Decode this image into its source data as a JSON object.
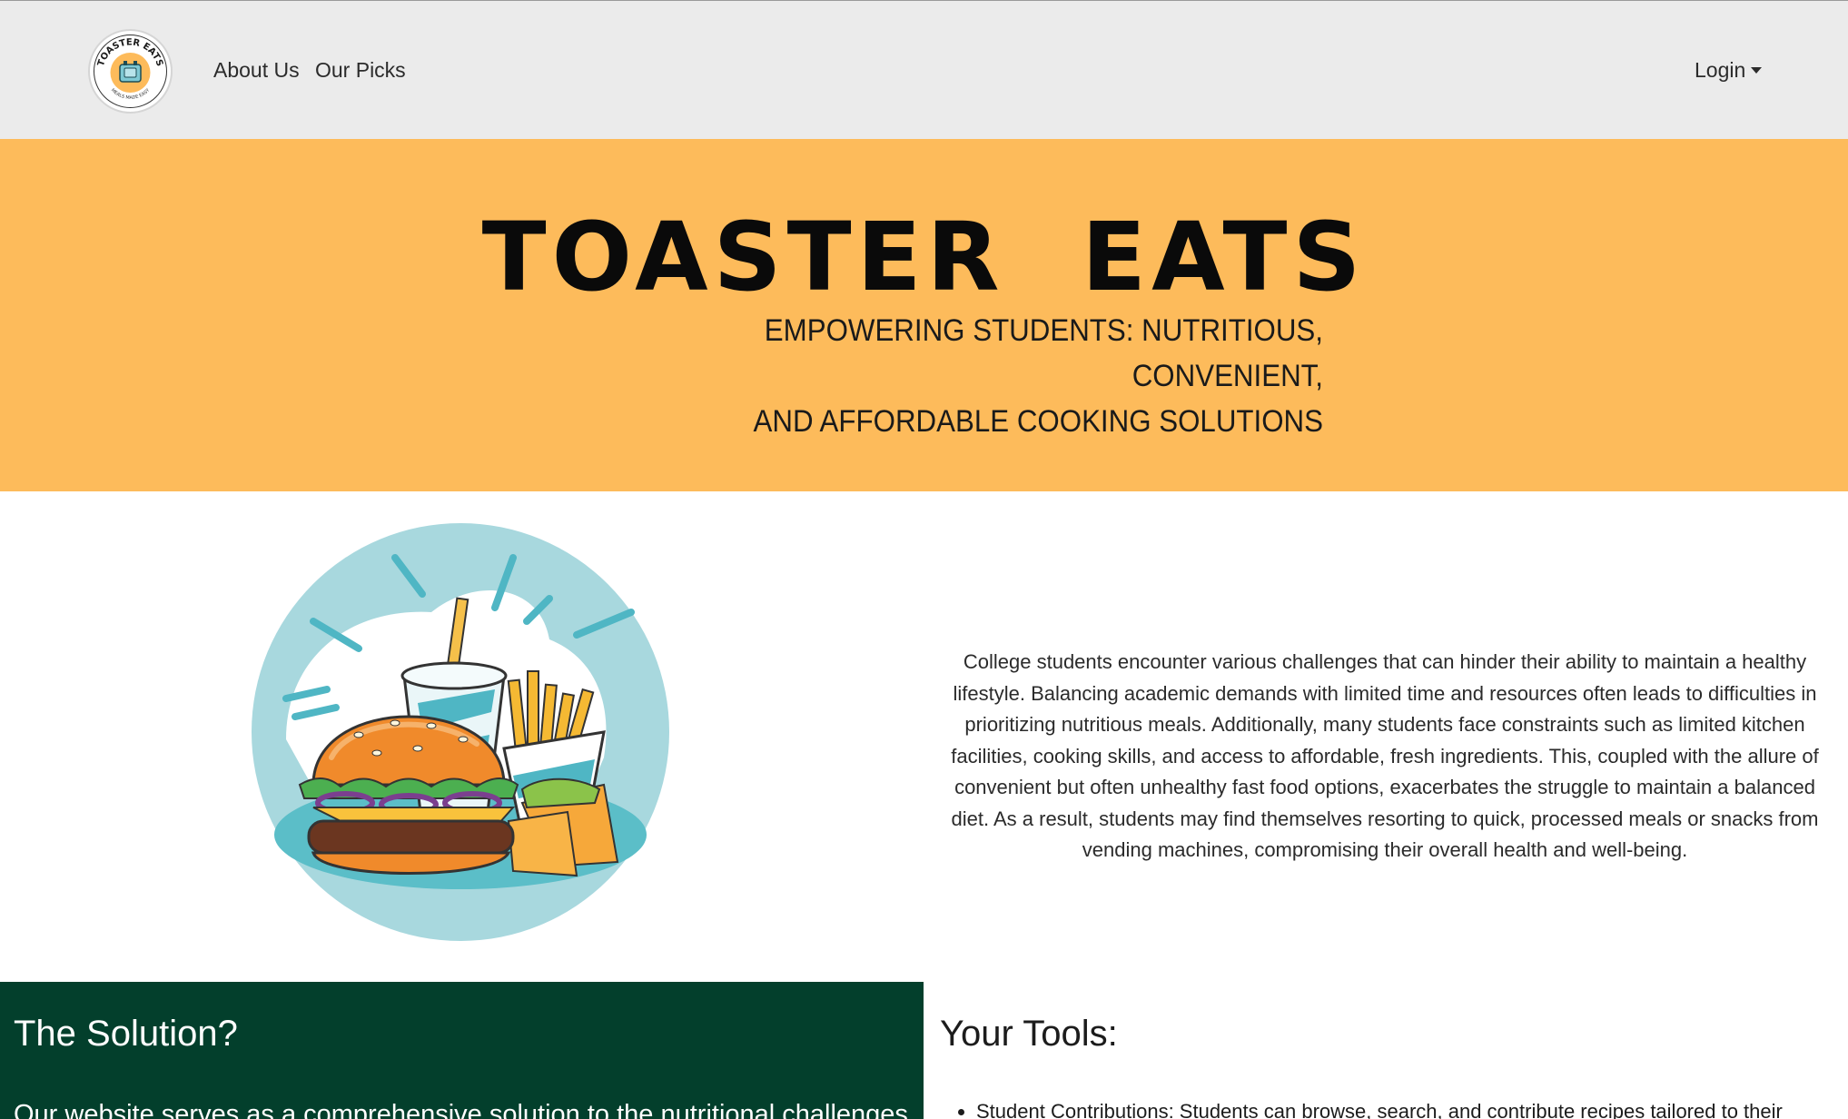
{
  "nav": {
    "logo_text": "TOASTER EATS",
    "logo_tagline": "MEALS MADE EASY",
    "about_label": "About Us",
    "picks_label": "Our Picks",
    "login_label": "Login"
  },
  "hero": {
    "title": "TOASTER  EATS",
    "subtitle_line1": "EMPOWERING STUDENTS: NUTRITIOUS, CONVENIENT,",
    "subtitle_line2": "AND AFFORDABLE COOKING SOLUTIONS"
  },
  "intro": {
    "paragraph": "College students encounter various challenges that can hinder their ability to maintain a healthy lifestyle. Balancing academic demands with limited time and resources often leads to difficulties in prioritizing nutritious meals. Additionally, many students face constraints such as limited kitchen facilities, cooking skills, and access to affordable, fresh ingredients. This, coupled with the allure of convenient but often unhealthy fast food options, exacerbates the struggle to maintain a balanced diet. As a result, students may find themselves resorting to quick, processed meals or snacks from vending machines, compromising their overall health and well-being."
  },
  "solution": {
    "title": "The Solution?",
    "text": "Our website serves as a comprehensive solution to the nutritional challenges"
  },
  "tools": {
    "title": "Your Tools:",
    "items": [
      "Student Contributions: Students can browse, search, and contribute recipes tailored to their"
    ]
  },
  "colors": {
    "navbar_bg": "#ebebeb",
    "hero_bg": "#fdbb5b",
    "solution_bg": "#033f2c"
  }
}
